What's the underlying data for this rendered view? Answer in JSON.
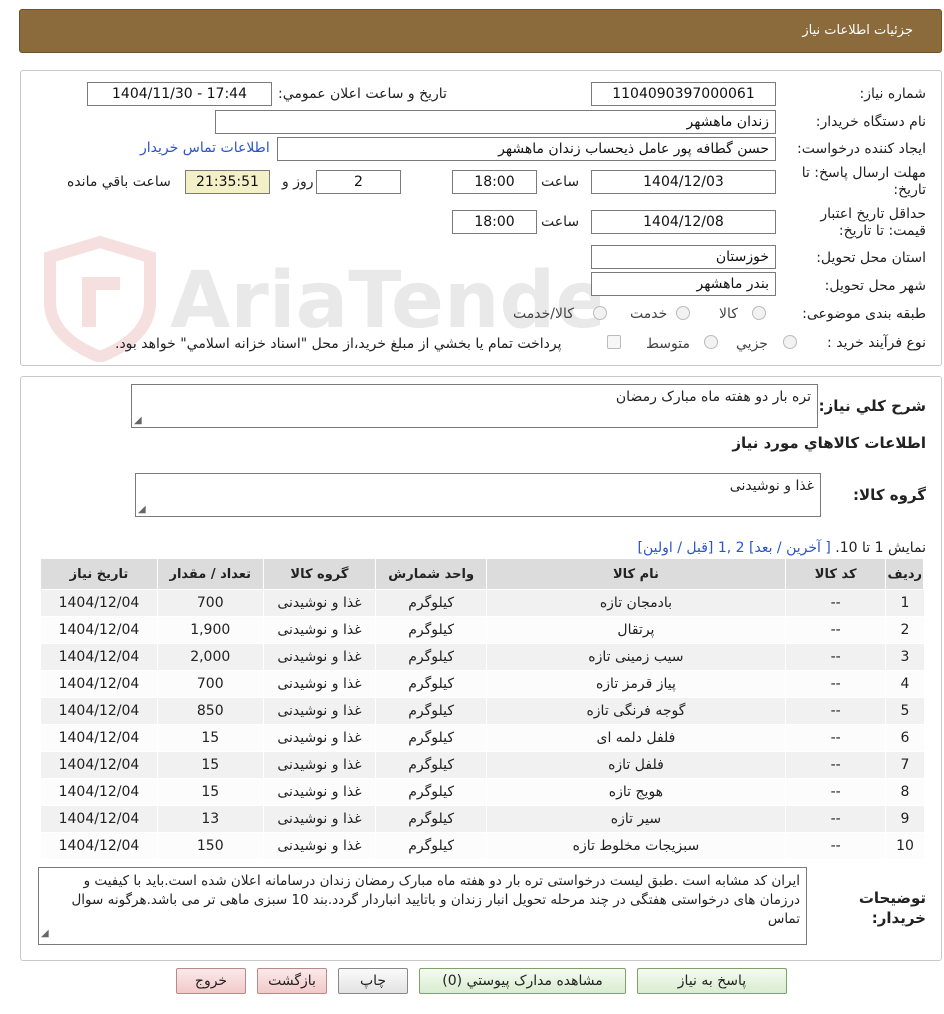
{
  "header": {
    "title": "جزئیات اطلاعات نیاز"
  },
  "watermark": {
    "brand": "AriaTender.neT"
  },
  "form": {
    "need_number_label": "شماره نیاز:",
    "need_number": "1104090397000061",
    "announce_label": "تاریخ و ساعت اعلان عمومي:",
    "announce_value": "1404/11/30 - 17:44",
    "buyer_org_label": "نام دستگاه خريدار:",
    "buyer_org": "زندان ماهشهر",
    "requester_label": "ايجاد کننده درخواست:",
    "requester": "حسن گطافه پور عامل ذیحساب زندان ماهشهر",
    "contact_link": "اطلاعات تماس خريدار",
    "deadline_label": "مهلت ارسال پاسخ: تا تاريخ:",
    "deadline_date": "1404/12/03",
    "time_label": "ساعت",
    "deadline_time": "18:00",
    "days_value": "2",
    "days_label": "روز و",
    "remaining_time": "21:35:51",
    "remaining_label": "ساعت باقي مانده",
    "validity_label": "حداقل تاريخ اعتبار قيمت: تا تاريخ:",
    "validity_date": "1404/12/08",
    "validity_time": "18:00",
    "province_label": "استان محل تحويل:",
    "province": "خوزستان",
    "city_label": "شهر محل تحويل:",
    "city": "بندر ماهشهر",
    "category_label": "طبقه بندی موضوعی:",
    "category_options": [
      "کالا",
      "خدمت",
      "کالا/خدمت"
    ],
    "process_label": "نوع فرآيند خريد :",
    "process_options": [
      "جزيي",
      "متوسط"
    ],
    "process_note": "پرداخت تمام يا بخشي از مبلغ خريد،از محل \"اسناد خزانه اسلامي\" خواهد بود."
  },
  "summary": {
    "label": "شرح کلي نياز:",
    "value": "تره بار دو هفته ماه مبارک رمضان",
    "goods_info_title": "اطلاعات کالاهاي مورد نياز",
    "group_label": "گروه کالا:",
    "group_value": "غذا و نوشیدنی"
  },
  "pagination": {
    "prefix": "نمايش 1 تا 10.",
    "nav": "[ آخرين / بعد] 2 ,1 [قبل / اولين]"
  },
  "table": {
    "headers": [
      "رديف",
      "کد کالا",
      "نام کالا",
      "واحد شمارش",
      "گروه کالا",
      "تعداد / مقدار",
      "تاريخ نياز"
    ],
    "rows": [
      [
        "1",
        "--",
        "بادمجان تازه",
        "کیلوگرم",
        "غذا و نوشیدنی",
        "700",
        "1404/12/04"
      ],
      [
        "2",
        "--",
        "پرتقال",
        "کیلوگرم",
        "غذا و نوشیدنی",
        "1,900",
        "1404/12/04"
      ],
      [
        "3",
        "--",
        "سیب زمینی تازه",
        "کیلوگرم",
        "غذا و نوشیدنی",
        "2,000",
        "1404/12/04"
      ],
      [
        "4",
        "--",
        "پیاز قرمز تازه",
        "کیلوگرم",
        "غذا و نوشیدنی",
        "700",
        "1404/12/04"
      ],
      [
        "5",
        "--",
        "گوجه فرنگی تازه",
        "کیلوگرم",
        "غذا و نوشیدنی",
        "850",
        "1404/12/04"
      ],
      [
        "6",
        "--",
        "فلفل دلمه ای",
        "کیلوگرم",
        "غذا و نوشیدنی",
        "15",
        "1404/12/04"
      ],
      [
        "7",
        "--",
        "فلفل تازه",
        "کیلوگرم",
        "غذا و نوشیدنی",
        "15",
        "1404/12/04"
      ],
      [
        "8",
        "--",
        "هویج تازه",
        "کیلوگرم",
        "غذا و نوشیدنی",
        "15",
        "1404/12/04"
      ],
      [
        "9",
        "--",
        "سیر تازه",
        "کیلوگرم",
        "غذا و نوشیدنی",
        "13",
        "1404/12/04"
      ],
      [
        "10",
        "--",
        "سبزیجات مخلوط تازه",
        "کیلوگرم",
        "غذا و نوشیدنی",
        "150",
        "1404/12/04"
      ]
    ]
  },
  "notes": {
    "label": "توضيحات خريدار:",
    "value": "ایران کد مشابه است .طبق لیست درخواستی تره بار دو هفته ماه مبارک رمضان زندان  درسامانه اعلان شده است.باید با کیفیت و درزمان های درخواستی هفتگی  در چند مرحله تحویل انبار زندان و باتایید انباردار گردد.بند 10 سبزی ماهی تر می باشد.هرگونه سوال تماس"
  },
  "buttons": {
    "reply": "پاسخ به نياز",
    "attachments": "مشاهده مدارک پيوستي (0)",
    "print": "چاپ",
    "back": "بازگشت",
    "exit": "خروج"
  }
}
